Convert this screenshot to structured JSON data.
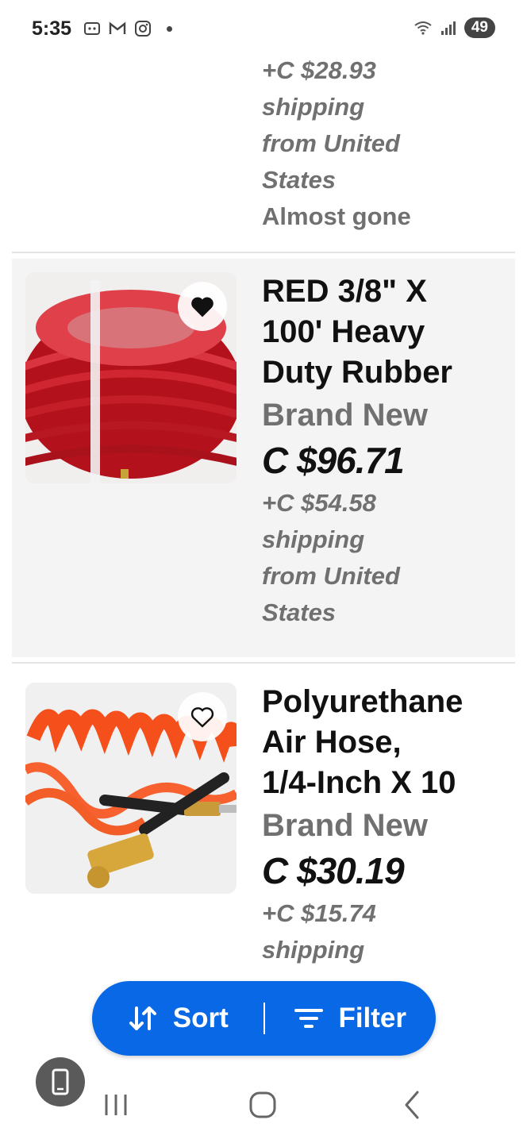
{
  "status_bar": {
    "time": "5:35",
    "battery": "49",
    "icons": [
      "screenshot-icon",
      "gmail-icon",
      "instagram-icon",
      "wifi-icon",
      "signal-icon"
    ]
  },
  "previous_item": {
    "shipping_lines": [
      "+C $28.93",
      "shipping",
      "from United",
      "States"
    ],
    "note": "Almost gone"
  },
  "listings": [
    {
      "title_lines": [
        "RED 3/8\" X",
        "100' Heavy",
        "Duty Rubber"
      ],
      "condition": "Brand New",
      "price": "C $96.71",
      "shipping_lines": [
        "+C $54.58",
        "shipping",
        "from United",
        "States"
      ],
      "favorited": true
    },
    {
      "title_lines": [
        "Polyurethane",
        "Air Hose,",
        "1/4-Inch X 10"
      ],
      "condition": "Brand New",
      "price": "C $30.19",
      "shipping_lines": [
        "+C $15.74",
        "shipping"
      ],
      "favorited": false
    }
  ],
  "actions": {
    "sort_label": "Sort",
    "filter_label": "Filter"
  },
  "colors": {
    "accent": "#0968e5",
    "muted_text": "#707070",
    "highlight_bg": "#f4f4f4"
  }
}
